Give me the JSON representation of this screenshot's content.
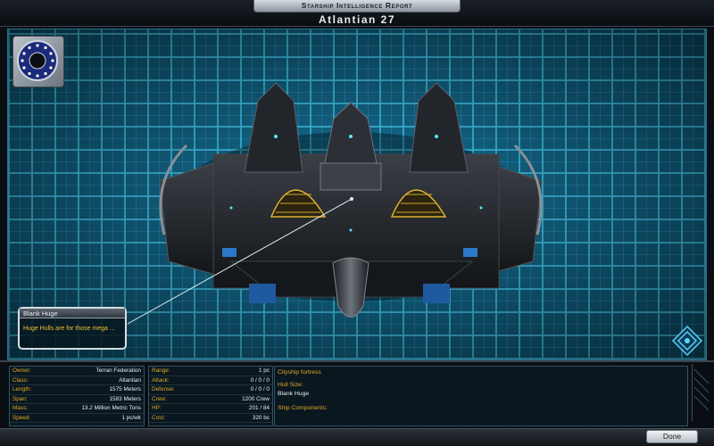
{
  "header": {
    "report_title": "Starship Intelligence Report",
    "ship_name": "Atlantian 27"
  },
  "tooltip": {
    "title": "Blank Huge",
    "text": "Huge Hulls are for those mega ..."
  },
  "stats_left": [
    {
      "label": "Owner:",
      "value": "Terran Federation"
    },
    {
      "label": "Class:",
      "value": "Atlantian"
    },
    {
      "label": "Length:",
      "value": "1575 Meters"
    },
    {
      "label": "Span:",
      "value": "1583 Meters"
    },
    {
      "label": "Mass:",
      "value": "13.2 Million Metric Tons"
    },
    {
      "label": "Speed:",
      "value": "1 pc/wk"
    }
  ],
  "stats_right": [
    {
      "label": "Range:",
      "value": "1 pc"
    },
    {
      "label": "Attack:",
      "value": "0 / 0 / 0"
    },
    {
      "label": "Defense:",
      "value": "0 / 0 / 0"
    },
    {
      "label": "Crew:",
      "value": "1200 Crew"
    },
    {
      "label": "HP:",
      "value": "201 / 84"
    },
    {
      "label": "Cost:",
      "value": "320 bc"
    }
  ],
  "description": {
    "type": "Cityship fortress",
    "hull_label": "Hull Size:",
    "hull_value": "Blank Huge",
    "components_label": "Ship Components:"
  },
  "footer": {
    "done_label": "Done"
  },
  "colors": {
    "grid": "#50dcff",
    "label": "#e0a92c",
    "hull_blue": "#2a78c8"
  },
  "icons": {
    "emblem": "federation-emblem-icon",
    "nav": "rotate-view-icon"
  }
}
